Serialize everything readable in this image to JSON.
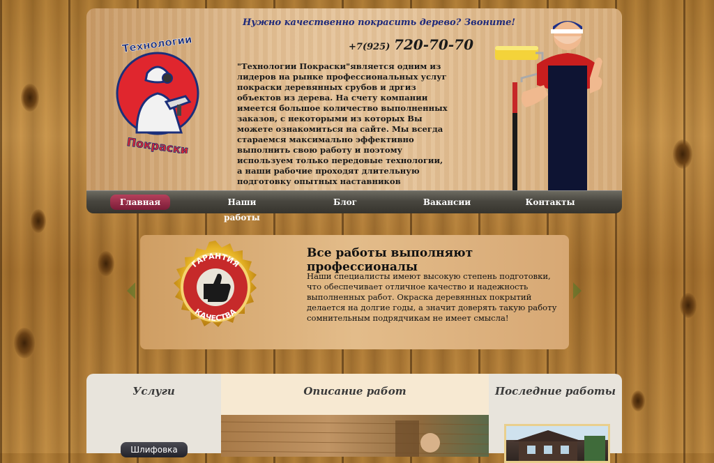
{
  "header": {
    "tagline": "Нужно качественно покрасить дерево? Звоните!",
    "phone_code": "+7(925)",
    "phone_number": "720-70-70",
    "about": "\"Технологии Покраски\"является одним из лидеров на рынке профессиональных услуг покраски деревянных срубов и дргиз объектов из дерева. На счету компании имеется большое количество выполненных заказов, с некоторыми из которых Вы можете ознакомиться на сайте. Мы всегда стараемся максимально эффективно выполнить свою работу и поэтому используем только передовые технологии, а наши рабочие проходят длительную подготовку опытных наставников",
    "logo": {
      "top_text": "Технологии",
      "bottom_text": "Покраски",
      "icon": "painter-spray-logo"
    }
  },
  "nav": {
    "items": [
      {
        "label": "Главная",
        "active": true
      },
      {
        "label": "Наши работы",
        "active": false
      },
      {
        "label": "Блог",
        "active": false
      },
      {
        "label": "Вакансии",
        "active": false
      },
      {
        "label": "Контакты",
        "active": false
      }
    ]
  },
  "slider": {
    "title": "Все работы выполняют профессионалы",
    "text": "Наши специалисты имеют высокую степень подготовки, что обеспечивает отличное качество и надежность выполненных работ. Окраска деревянных покрытий делается на долгие годы, а значит доверять такую работу сомнительным подрядчикам не имеет смысла!",
    "badge": {
      "line1": "ГАРАНТИЯ",
      "line2": "КАЧЕСТВА",
      "icon": "thumbs-up-icon"
    }
  },
  "columns": {
    "services_title": "Услуги",
    "services_first_button": "Шлифовка",
    "works_title": "Описание работ",
    "recent_title": "Последние работы"
  },
  "colors": {
    "nav_active": "#a0324d",
    "nav_bg": "#48463f",
    "tagline": "#1f2a7a",
    "panel": "#e3c095"
  }
}
